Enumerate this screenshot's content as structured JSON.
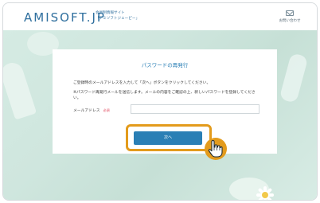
{
  "header": {
    "logo": "AMISOFT.JP",
    "tagline_line1": "会員制情報サイト",
    "tagline_line2": "「アミソフトジェーピー」",
    "contact_label": "お問い合わせ"
  },
  "card": {
    "title": "パスワードの再発行",
    "instruction1": "ご登録時のメールアドレスを入力して「次へ」ボタンをクリックしてください。",
    "instruction2": "※パスワード再発行メールを送信します。メールの内容をご確認の上、新しいパスワードを登録してください。",
    "email_label": "メールアドレス",
    "required_label": "必須",
    "email_value": "",
    "next_label": "次へ"
  },
  "colors": {
    "brand": "#2f6f9e",
    "button": "#2a7fb5",
    "highlight": "#e39b1c",
    "required": "#e0445a"
  },
  "icons": [
    "mail-icon",
    "pointing-hand-icon"
  ]
}
